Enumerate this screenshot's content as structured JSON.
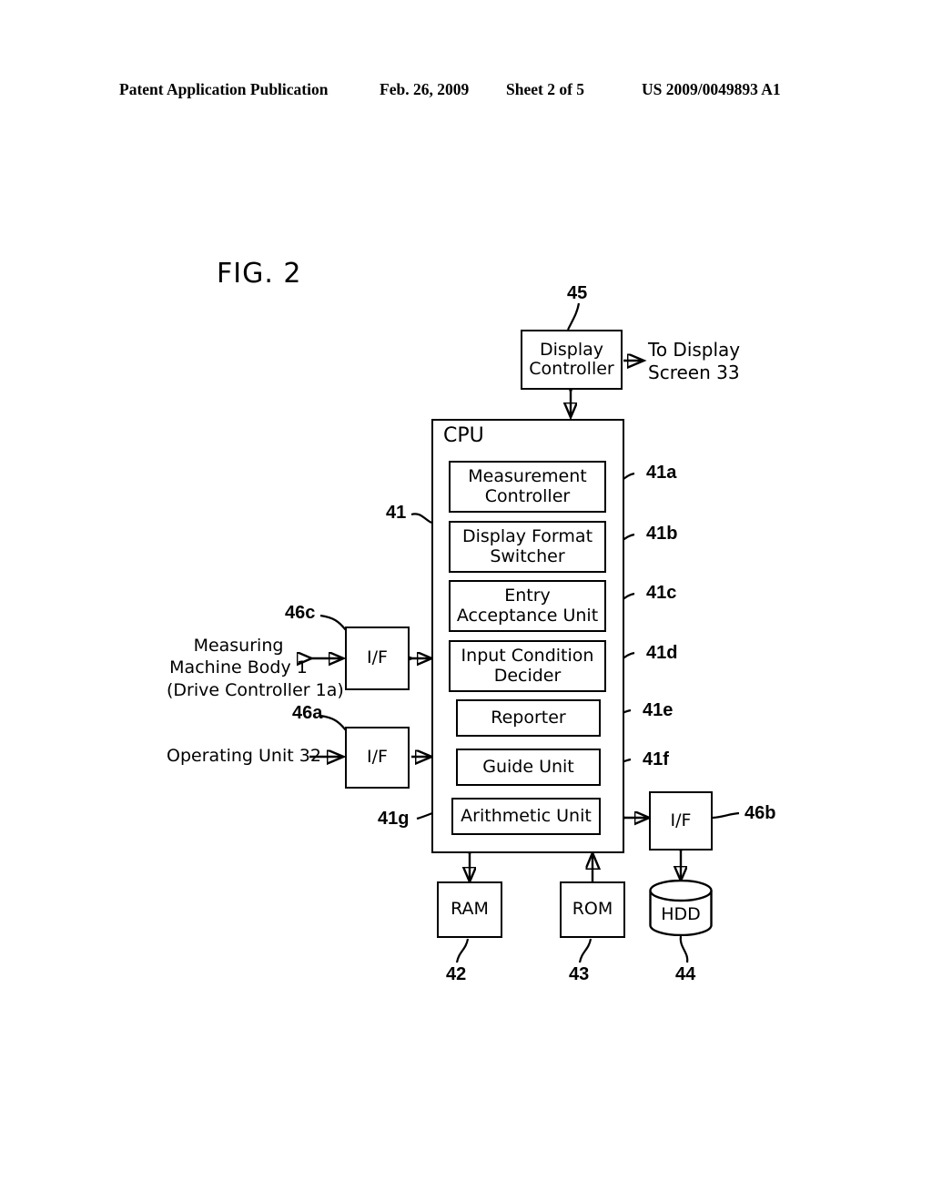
{
  "header": {
    "left": "Patent Application Publication",
    "date": "Feb. 26, 2009",
    "sheet": "Sheet 2 of 5",
    "pub_number": "US 2009/0049893 A1"
  },
  "figure": {
    "label": "FIG. 2"
  },
  "diagram": {
    "display_controller": {
      "text": "Display\nController",
      "line1": "Display",
      "line2": "Controller",
      "ref": "45"
    },
    "to_display_screen": {
      "line1": "To Display",
      "line2": "Screen 33"
    },
    "cpu": {
      "title": "CPU",
      "ref": "41",
      "units": [
        {
          "line1": "Measurement",
          "line2": "Controller",
          "ref": "41a",
          "lines": 2
        },
        {
          "line1": "Display Format",
          "line2": "Switcher",
          "ref": "41b",
          "lines": 2
        },
        {
          "line1": "Entry",
          "line2": "Acceptance Unit",
          "ref": "41c",
          "lines": 2
        },
        {
          "line1": "Input Condition",
          "line2": "Decider",
          "ref": "41d",
          "lines": 2
        },
        {
          "line1": "Reporter",
          "line2": "",
          "ref": "41e",
          "lines": 1
        },
        {
          "line1": "Guide Unit",
          "line2": "",
          "ref": "41f",
          "lines": 1
        },
        {
          "line1": "Arithmetic Unit",
          "line2": "",
          "ref": "41g",
          "lines": 1
        }
      ]
    },
    "interfaces": [
      {
        "label": "I/F",
        "ref": "46c",
        "name": "if-measuring-machine"
      },
      {
        "label": "I/F",
        "ref": "46a",
        "name": "if-operating-unit"
      },
      {
        "label": "I/F",
        "ref": "46b",
        "name": "if-hdd"
      }
    ],
    "measuring_machine": {
      "line1": "Measuring",
      "line2": "Machine Body 1",
      "line3": "(Drive Controller 1a)"
    },
    "operating_unit": {
      "text": "Operating Unit 32"
    },
    "memories": [
      {
        "label": "RAM",
        "ref": "42",
        "shape": "rect"
      },
      {
        "label": "ROM",
        "ref": "43",
        "shape": "rect"
      },
      {
        "label": "HDD",
        "ref": "44",
        "shape": "cylinder"
      }
    ]
  }
}
